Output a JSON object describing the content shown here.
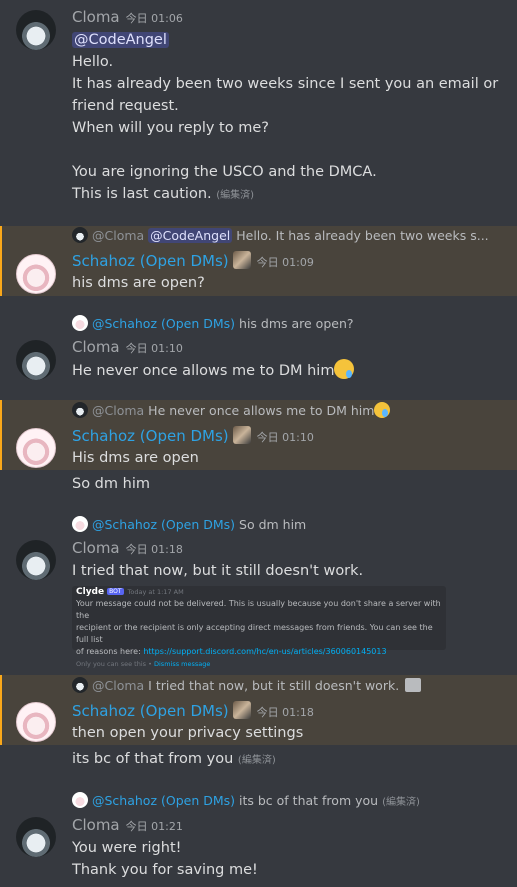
{
  "messages": {
    "m1": {
      "author": "Cloma",
      "time": "今日 01:06",
      "mention": "@CodeAngel",
      "lines": [
        "Hello.",
        "It has already been two weeks since I sent you an email or",
        "friend request.",
        "When will you reply to me?",
        "You are ignoring the USCO and the DMCA.",
        "This is last caution."
      ],
      "edited": "(編集済)"
    },
    "m2": {
      "reply_author": "@Cloma",
      "reply_mention": "@CodeAngel",
      "reply_text": "Hello. It has already been two weeks s...",
      "author": "Schahoz (Open DMs)",
      "time": "今日 01:09",
      "text": "his dms are open?"
    },
    "m3": {
      "reply_author": "@Schahoz (Open DMs)",
      "reply_text": "his dms are open?",
      "author": "Cloma",
      "time": "今日 01:10",
      "text": "He never once allows me to DM him"
    },
    "m4": {
      "reply_author": "@Cloma",
      "reply_text": "He never once allows me to DM him",
      "author": "Schahoz (Open DMs)",
      "time": "今日 01:10",
      "text": "His dms are open",
      "followup": "So dm him"
    },
    "m5": {
      "reply_author": "@Schahoz (Open DMs)",
      "reply_text": "So dm him",
      "author": "Cloma",
      "time": "今日 01:18",
      "text": "I tried that now, but it still doesn't work.",
      "embed": {
        "bot_name": "Clyde",
        "bot_tag": "BOT",
        "bot_time": "Today at 1:17 AM",
        "body1": "Your message could not be delivered. This is usually because you don't share a server with the",
        "body2": "recipient or the recipient is only accepting direct messages from friends. You can see the full list",
        "body3": "of reasons here:",
        "link": "https://support.discord.com/hc/en-us/articles/360060145013",
        "only": "Only you can see this •",
        "dismiss": "Dismiss message"
      }
    },
    "m6": {
      "reply_author": "@Cloma",
      "reply_text": "I tried that now, but it still doesn't work.",
      "author": "Schahoz (Open DMs)",
      "time": "今日 01:18",
      "text": "then open your privacy settings",
      "followup": "its bc of that from you",
      "followup_edited": "(編集済)"
    },
    "m7": {
      "reply_author": "@Schahoz (Open DMs)",
      "reply_text": "its bc of that from you",
      "reply_edited": "(編集済)",
      "author": "Cloma",
      "time": "今日 01:21",
      "line1": "You were right!",
      "line2": "Thank you for saving me!"
    }
  },
  "colors": {
    "background": "#36393f",
    "highlight": "#49443c",
    "highlight_bar": "#faa81a",
    "schahoz_name": "#2ea2e3",
    "mention_bg": "#414675"
  }
}
